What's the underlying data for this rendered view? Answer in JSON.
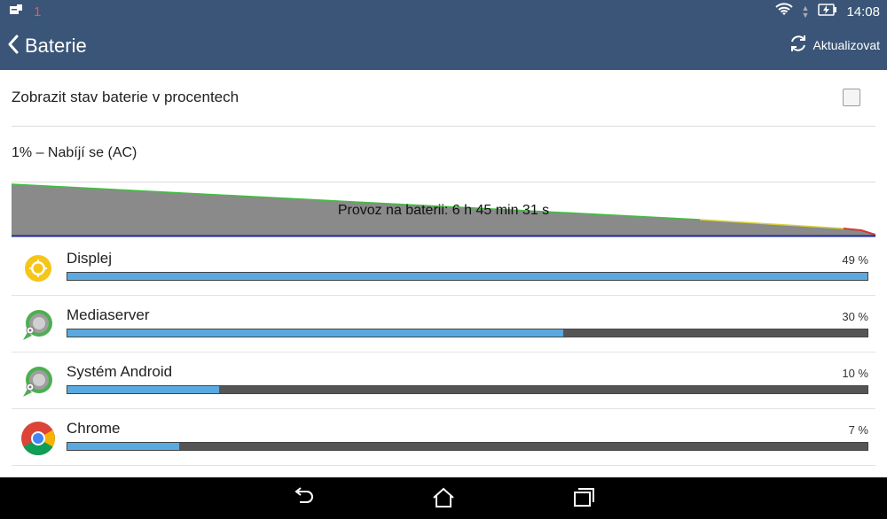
{
  "status_bar": {
    "notification_count": "1",
    "time": "14:08"
  },
  "app_bar": {
    "title": "Baterie",
    "refresh_label": "Aktualizovat"
  },
  "settings": {
    "show_percent_label": "Zobrazit stav baterie v procentech",
    "show_percent_checked": false
  },
  "battery": {
    "status_text": "1% – Nabíjí se (AC)",
    "graph_label": "Provoz na baterii: 6 h 45 min 31 s"
  },
  "apps": [
    {
      "name": "Displej",
      "percent_label": "49 %",
      "fraction": 1.0,
      "icon": "brightness-icon"
    },
    {
      "name": "Mediaserver",
      "percent_label": "30 %",
      "fraction": 0.62,
      "icon": "android-system-icon"
    },
    {
      "name": "Systém Android",
      "percent_label": "10 %",
      "fraction": 0.19,
      "icon": "android-system-icon"
    },
    {
      "name": "Chrome",
      "percent_label": "7 %",
      "fraction": 0.14,
      "icon": "chrome-icon"
    }
  ],
  "colors": {
    "app_bar": "#3a5577",
    "bar_fill": "#5aa9e0",
    "bar_track": "#555555",
    "graph_fill": "#8a8a8a",
    "graph_line_green": "#3fbf3f",
    "graph_line_yellow": "#d6d23a",
    "graph_line_red": "#d23a3a",
    "graph_baseline": "#1a2a99"
  }
}
